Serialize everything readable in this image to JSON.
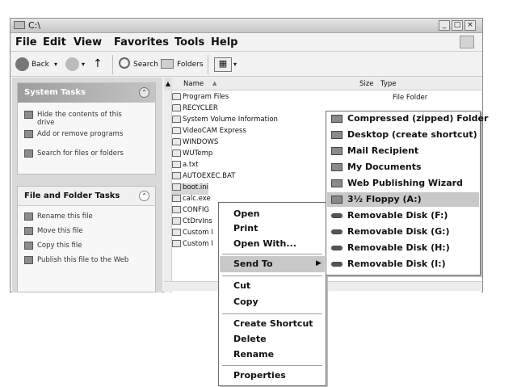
{
  "window": {
    "title": "C:\\"
  },
  "menubar": {
    "items": [
      "File",
      "Edit",
      "View",
      "Favorites",
      "Tools",
      "Help"
    ]
  },
  "toolbar": {
    "back_label": "Back",
    "search_label": "Search",
    "folders_label": "Folders"
  },
  "left_pane": {
    "system_tasks": {
      "title": "System Tasks",
      "items": [
        "Hide the contents of this drive",
        "Add or remove programs",
        "Search for files or folders"
      ]
    },
    "file_folder_tasks": {
      "title": "File and Folder Tasks",
      "items": [
        "Rename this file",
        "Move this file",
        "Copy this file",
        "Publish this file to the Web"
      ]
    }
  },
  "file_list": {
    "columns": {
      "name": "Name",
      "size": "Size",
      "type": "Type"
    },
    "rows": [
      {
        "name": "Program Files",
        "type": "File Folder",
        "icon": "folder-icon"
      },
      {
        "name": "RECYCLER",
        "icon": "folder-icon"
      },
      {
        "name": "System Volume Information",
        "icon": "folder-icon"
      },
      {
        "name": "VideoCAM Express",
        "icon": "folder-icon"
      },
      {
        "name": "WINDOWS",
        "icon": "folder-icon"
      },
      {
        "name": "WUTemp",
        "icon": "folder-icon"
      },
      {
        "name": "a.txt",
        "icon": "file-icon"
      },
      {
        "name": "AUTOEXEC.BAT",
        "icon": "file-icon"
      },
      {
        "name": "boot.ini",
        "icon": "file-icon"
      },
      {
        "name": "calc.exe",
        "icon": "file-icon"
      },
      {
        "name": "CONFIG",
        "icon": "file-icon"
      },
      {
        "name": "CtDrvIns",
        "icon": "file-icon"
      },
      {
        "name": "Custom I",
        "icon": "file-icon"
      },
      {
        "name": "Custom I",
        "icon": "file-icon"
      }
    ]
  },
  "context_menu": {
    "open": "Open",
    "print": "Print",
    "open_with": "Open With...",
    "send_to": "Send To",
    "cut": "Cut",
    "copy": "Copy",
    "create_shortcut": "Create Shortcut",
    "delete": "Delete",
    "rename": "Rename",
    "properties": "Properties"
  },
  "send_to_menu": {
    "items": [
      {
        "label": "Compressed (zipped) Folder",
        "icon": "zip-folder-icon"
      },
      {
        "label": "Desktop (create shortcut)",
        "icon": "desktop-icon"
      },
      {
        "label": "Mail Recipient",
        "icon": "mail-icon"
      },
      {
        "label": "My Documents",
        "icon": "documents-icon"
      },
      {
        "label": "Web Publishing Wizard",
        "icon": "globe-icon"
      },
      {
        "label": "3½ Floppy (A:)",
        "icon": "floppy-icon"
      },
      {
        "label": "Removable Disk (F:)",
        "icon": "removable-disk-icon"
      },
      {
        "label": "Removable Disk (G:)",
        "icon": "removable-disk-icon"
      },
      {
        "label": "Removable Disk (H:)",
        "icon": "removable-disk-icon"
      },
      {
        "label": "Removable Disk (I:)",
        "icon": "removable-disk-icon"
      }
    ]
  }
}
